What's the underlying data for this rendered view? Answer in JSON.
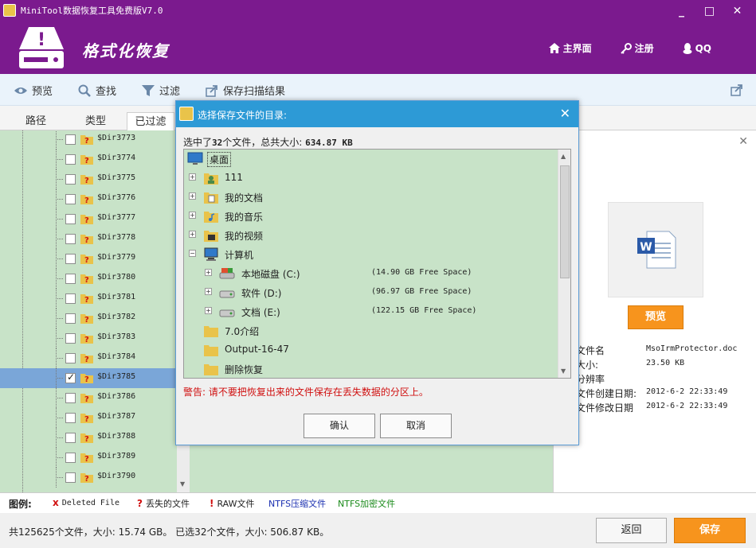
{
  "window": {
    "title": "MiniTool数据恢复工具免费版V7.0",
    "brand_text": "格式化恢复",
    "minimize": "_",
    "maximize": "□",
    "close": "✕"
  },
  "topnav": {
    "home": "主界面",
    "register": "注册",
    "qq": "QQ"
  },
  "toolbar": {
    "preview": "预览",
    "find": "查找",
    "filter": "过滤",
    "save_scan": "保存扫描结果"
  },
  "tabs": [
    {
      "label": "路径"
    },
    {
      "label": "类型"
    },
    {
      "label": "已过滤"
    }
  ],
  "tree": {
    "items": [
      {
        "label": "$Dir3773",
        "checked": false
      },
      {
        "label": "$Dir3774",
        "checked": false
      },
      {
        "label": "$Dir3775",
        "checked": false
      },
      {
        "label": "$Dir3776",
        "checked": false
      },
      {
        "label": "$Dir3777",
        "checked": false
      },
      {
        "label": "$Dir3778",
        "checked": false
      },
      {
        "label": "$Dir3779",
        "checked": false
      },
      {
        "label": "$Dir3780",
        "checked": false
      },
      {
        "label": "$Dir3781",
        "checked": false
      },
      {
        "label": "$Dir3782",
        "checked": false
      },
      {
        "label": "$Dir3783",
        "checked": false
      },
      {
        "label": "$Dir3784",
        "checked": false
      },
      {
        "label": "$Dir3785",
        "checked": true,
        "selected": true
      },
      {
        "label": "$Dir3786",
        "checked": false
      },
      {
        "label": "$Dir3787",
        "checked": false
      },
      {
        "label": "$Dir3788",
        "checked": false
      },
      {
        "label": "$Dir3789",
        "checked": false
      },
      {
        "label": "$Dir3790",
        "checked": false
      }
    ]
  },
  "preview": {
    "button": "预览",
    "info": [
      {
        "key": "文件名",
        "value": "MsoIrmProtector.doc"
      },
      {
        "key": "大小:",
        "value": "23.50 KB"
      },
      {
        "key": "分辨率",
        "value": ""
      },
      {
        "key": "文件创建日期:",
        "value": "2012-6-2 22:33:49"
      },
      {
        "key": "文件修改日期",
        "value": "2012-6-2 22:33:49"
      }
    ]
  },
  "legend": {
    "title": "图例:",
    "items": [
      {
        "mark": "x",
        "label": "Deleted File",
        "color": "#d01010"
      },
      {
        "mark": "?",
        "label": "丢失的文件",
        "color": "#d01010"
      },
      {
        "mark": "!",
        "label": "RAW文件",
        "color": "#d01010"
      },
      {
        "mark": "",
        "label": "NTFS压缩文件",
        "color": "#1a2fb0"
      },
      {
        "mark": "",
        "label": "NTFS加密文件",
        "color": "#1a8a1a"
      }
    ]
  },
  "status": {
    "text": "共125625个文件，大小: 15.74 GB。 已选32个文件，大小: 506.87 KB。",
    "back": "返回",
    "save": "保存"
  },
  "dialog": {
    "title": "选择保存文件的目录:",
    "close": "✕",
    "summary_prefix": "选中了",
    "summary_count": "32",
    "summary_mid": "个文件，总共大小:",
    "summary_size": "634.87 KB",
    "rows": [
      {
        "name": "桌面",
        "icon": "desktop",
        "level": 0,
        "expander": "",
        "free": "",
        "focused": true
      },
      {
        "name": "111",
        "icon": "user-folder",
        "level": 1,
        "expander": "+",
        "free": ""
      },
      {
        "name": "我的文档",
        "icon": "documents-folder",
        "level": 1,
        "expander": "+",
        "free": ""
      },
      {
        "name": "我的音乐",
        "icon": "music-folder",
        "level": 1,
        "expander": "+",
        "free": ""
      },
      {
        "name": "我的视频",
        "icon": "video-folder",
        "level": 1,
        "expander": "+",
        "free": ""
      },
      {
        "name": "计算机",
        "icon": "computer",
        "level": 1,
        "expander": "−",
        "free": ""
      },
      {
        "name": "本地磁盘 (C:)",
        "icon": "system-drive",
        "level": 2,
        "expander": "+",
        "free": "(14.90 GB Free Space)"
      },
      {
        "name": "软件 (D:)",
        "icon": "drive",
        "level": 2,
        "expander": "+",
        "free": "(96.97 GB Free Space)"
      },
      {
        "name": "文档 (E:)",
        "icon": "drive",
        "level": 2,
        "expander": "+",
        "free": "(122.15 GB Free Space)"
      },
      {
        "name": "7.0介绍",
        "icon": "folder",
        "level": 1,
        "expander": "",
        "free": ""
      },
      {
        "name": "Output-16-47",
        "icon": "folder",
        "level": 1,
        "expander": "",
        "free": ""
      },
      {
        "name": "删除恢复",
        "icon": "folder",
        "level": 1,
        "expander": "",
        "free": ""
      }
    ],
    "warning": "警告: 请不要把恢复出来的文件保存在丢失数据的分区上。",
    "ok": "确认",
    "cancel": "取消"
  },
  "colors": {
    "brand_purple": "#7b1a8e",
    "dialog_blue": "#2d9ad6",
    "accent_orange": "#f7941d",
    "tree_green": "#c8e3c8",
    "selection_blue": "#7aa6d8",
    "warning_red": "#d01010"
  }
}
